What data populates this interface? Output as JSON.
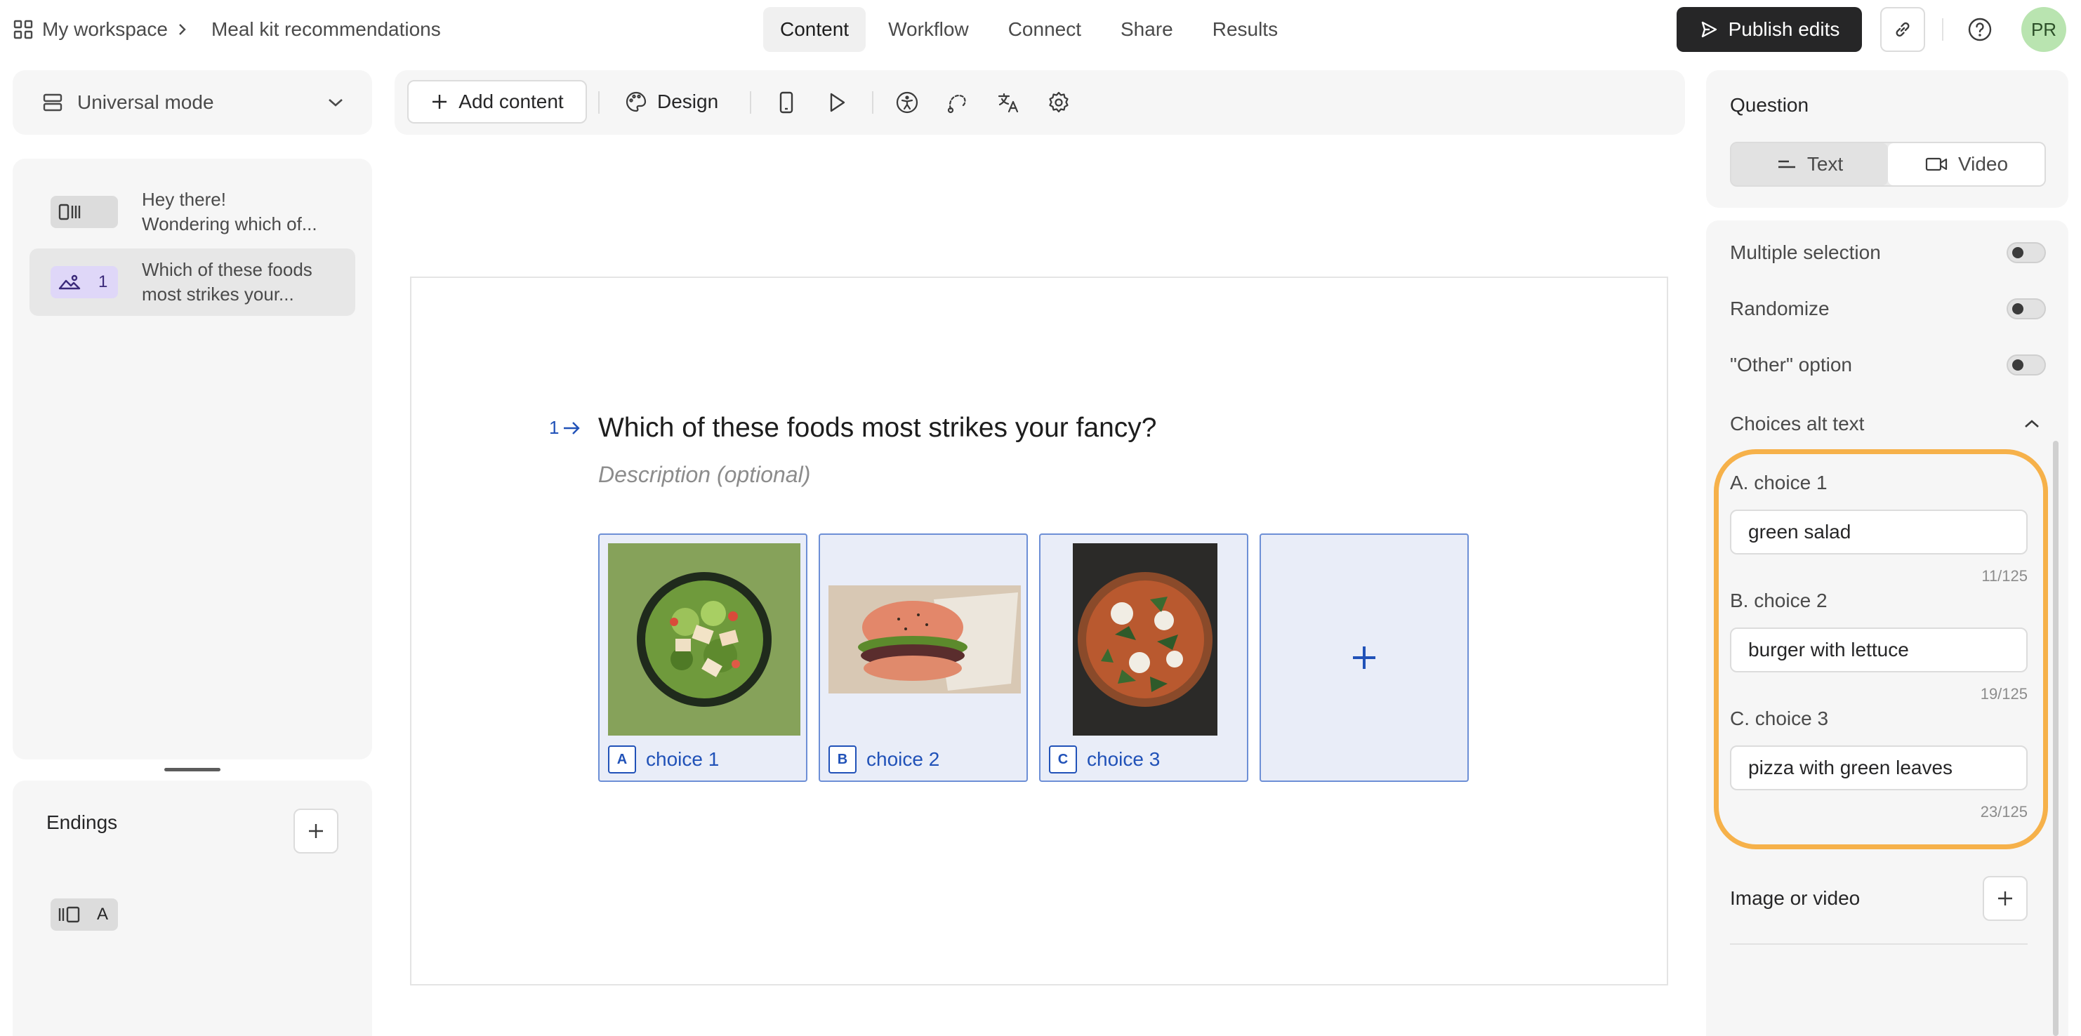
{
  "topbar": {
    "workspace": "My workspace",
    "form_title": "Meal kit recommendations",
    "tabs": [
      "Content",
      "Workflow",
      "Connect",
      "Share",
      "Results"
    ],
    "active_tab": "Content",
    "publish_label": "Publish edits",
    "avatar_initials": "PR"
  },
  "sidebar": {
    "mode_label": "Universal mode",
    "blocks": [
      {
        "line1": "Hey there!",
        "line2": "Wondering which of..."
      },
      {
        "number": "1",
        "line1": "Which of these foods",
        "line2": "most strikes your..."
      }
    ],
    "endings_title": "Endings",
    "ending_items": [
      {
        "letter": "A"
      }
    ]
  },
  "toolbar": {
    "add_content_label": "Add content",
    "design_label": "Design"
  },
  "question": {
    "number": "1",
    "title": "Which of these foods most strikes your fancy?",
    "description_placeholder": "Description (optional)",
    "choices": [
      {
        "key": "A",
        "label": "choice 1"
      },
      {
        "key": "B",
        "label": "choice 2"
      },
      {
        "key": "C",
        "label": "choice 3"
      }
    ]
  },
  "settings": {
    "question_heading": "Question",
    "type_options": [
      "Text",
      "Video"
    ],
    "type_selected": "Text",
    "toggles": [
      {
        "label": "Multiple selection",
        "on": false
      },
      {
        "label": "Randomize",
        "on": false
      },
      {
        "label": "\"Other\" option",
        "on": false
      }
    ],
    "alt_text_heading": "Choices alt text",
    "alt_texts": [
      {
        "label": "A. choice 1",
        "value": "green salad",
        "count": "11/125"
      },
      {
        "label": "B. choice 2",
        "value": "burger with lettuce",
        "count": "19/125"
      },
      {
        "label": "C. choice 3",
        "value": "pizza with green leaves",
        "count": "23/125"
      }
    ],
    "image_or_video_label": "Image or video"
  },
  "colors": {
    "accent_blue": "#2152b8",
    "highlight_orange": "#f6b14a",
    "publish_bg": "#262627",
    "avatar_bg": "#b9e4b0"
  },
  "icons": [
    "apps-grid-icon",
    "chevron-right-icon",
    "send-icon",
    "link-icon",
    "help-icon",
    "layers-icon",
    "chevron-down-icon",
    "plus-icon",
    "palette-icon",
    "mobile-icon",
    "play-icon",
    "accessibility-icon",
    "logic-icon",
    "translate-icon",
    "gear-icon",
    "text-icon",
    "video-icon",
    "chevron-up-icon",
    "welcome-screen-icon",
    "picture-choice-icon",
    "ending-screen-icon",
    "arrow-right-icon"
  ]
}
